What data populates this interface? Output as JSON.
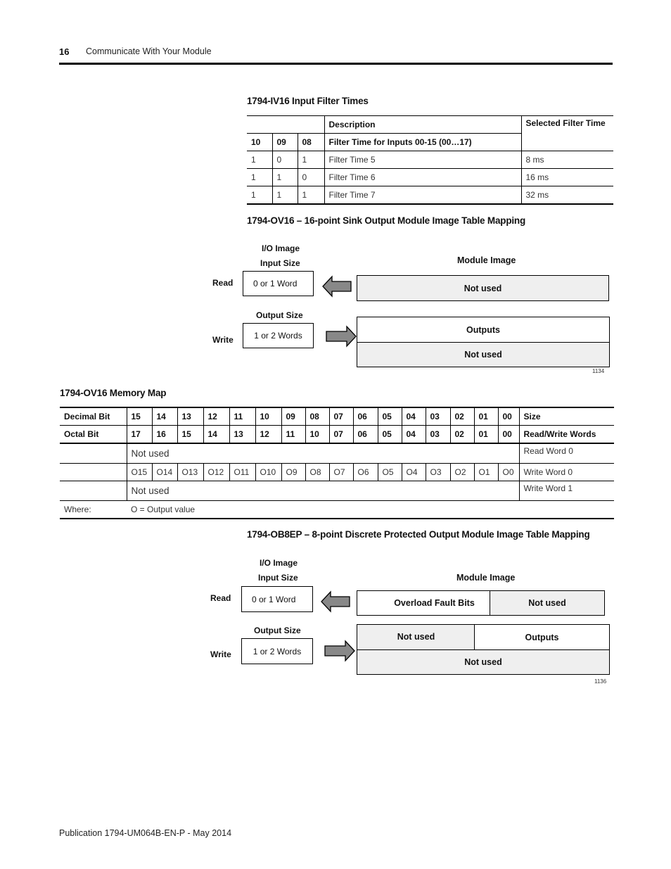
{
  "header": {
    "page_number": "16",
    "chapter_title": "Communicate With Your Module"
  },
  "filter_table": {
    "title": "1794-IV16 Input Filter Times",
    "header_description": "Description",
    "header_selected": "Selected Filter Time",
    "bit_headers": [
      "10",
      "09",
      "08"
    ],
    "subheader_description": "Filter Time for Inputs 00-15 (00…17)",
    "rows": [
      {
        "b10": "1",
        "b09": "0",
        "b08": "1",
        "description": "Filter Time 5",
        "time": "8 ms"
      },
      {
        "b10": "1",
        "b09": "1",
        "b08": "0",
        "description": "Filter Time 6",
        "time": "16 ms"
      },
      {
        "b10": "1",
        "b09": "1",
        "b08": "1",
        "description": "Filter Time 7",
        "time": "32 ms"
      }
    ]
  },
  "ov16_mapping": {
    "title": "1794-OV16 – 16-point Sink Output Module Image Table Mapping",
    "io_image_label": "I/O Image",
    "input_size_label": "Input Size",
    "output_size_label": "Output Size",
    "read_label": "Read",
    "write_label": "Write",
    "read_box": "0 or 1 Word",
    "write_box": "1 or 2 Words",
    "module_image_label": "Module Image",
    "read_module": "Not used",
    "write_module_top": "Outputs",
    "write_module_bottom": "Not used",
    "figure_number": "1134"
  },
  "memory_map": {
    "title": "1794-OV16 Memory Map",
    "decimal_label": "Decimal Bit",
    "octal_label": "Octal Bit",
    "decimal_bits": [
      "15",
      "14",
      "13",
      "12",
      "11",
      "10",
      "09",
      "08",
      "07",
      "06",
      "05",
      "04",
      "03",
      "02",
      "01",
      "00"
    ],
    "octal_bits": [
      "17",
      "16",
      "15",
      "14",
      "13",
      "12",
      "11",
      "10",
      "07",
      "06",
      "05",
      "04",
      "03",
      "02",
      "01",
      "00"
    ],
    "size_label": "Size",
    "rw_label": "Read/Write Words",
    "row_read": {
      "content": "Not used",
      "size": "Read Word 0"
    },
    "row_write0": {
      "values": [
        "O15",
        "O14",
        "O13",
        "O12",
        "O11",
        "O10",
        "O9",
        "O8",
        "O7",
        "O6",
        "O5",
        "O4",
        "O3",
        "O2",
        "O1",
        "O0"
      ],
      "size": "Write Word 0"
    },
    "row_write1": {
      "content": "Not used",
      "size": "Write Word 1"
    },
    "where_label": "Where:",
    "where_text": "O = Output value"
  },
  "ob8ep_mapping": {
    "title": "1794-OB8EP – 8-point Discrete Protected Output Module Image Table Mapping",
    "io_image_label": "I/O Image",
    "input_size_label": "Input Size",
    "output_size_label": "Output Size",
    "read_label": "Read",
    "write_label": "Write",
    "read_box": "0 or 1 Word",
    "write_box": "1 or 2 Words",
    "module_image_label": "Module Image",
    "read_module_left": "Overload Fault Bits",
    "read_module_right": "Not used",
    "write_module_top_left": "Not used",
    "write_module_top_right": "Outputs",
    "write_module_bottom": "Not used",
    "figure_number": "1136"
  },
  "footer": {
    "publication": "Publication 1794-UM064B-EN-P - May 2014"
  }
}
